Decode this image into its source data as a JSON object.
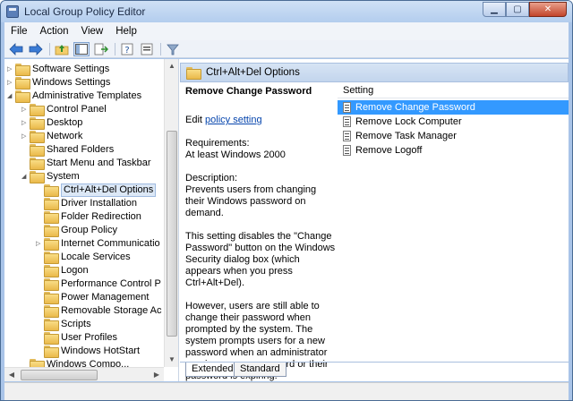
{
  "window": {
    "title": "Local Group Policy Editor"
  },
  "menu": [
    "File",
    "Action",
    "View",
    "Help"
  ],
  "toolbar_icons": [
    "back-arrow-icon",
    "forward-arrow-icon",
    "up-folder-icon",
    "show-hide-tree-icon",
    "export-list-icon",
    "help-icon",
    "properties-icon",
    "filter-icon"
  ],
  "tree": [
    {
      "label": "Software Settings",
      "level": 1,
      "expander": "▷"
    },
    {
      "label": "Windows Settings",
      "level": 1,
      "expander": "▷"
    },
    {
      "label": "Administrative Templates",
      "level": 1,
      "expander": "◢"
    },
    {
      "label": "Control Panel",
      "level": 2,
      "expander": "▷"
    },
    {
      "label": "Desktop",
      "level": 2,
      "expander": "▷"
    },
    {
      "label": "Network",
      "level": 2,
      "expander": "▷"
    },
    {
      "label": "Shared Folders",
      "level": 2,
      "expander": ""
    },
    {
      "label": "Start Menu and Taskbar",
      "level": 2,
      "expander": ""
    },
    {
      "label": "System",
      "level": 2,
      "expander": "◢"
    },
    {
      "label": "Ctrl+Alt+Del Options",
      "level": 3,
      "expander": "",
      "selected": true
    },
    {
      "label": "Driver Installation",
      "level": 3,
      "expander": ""
    },
    {
      "label": "Folder Redirection",
      "level": 3,
      "expander": ""
    },
    {
      "label": "Group Policy",
      "level": 3,
      "expander": ""
    },
    {
      "label": "Internet Communicatio",
      "level": 3,
      "expander": "▷"
    },
    {
      "label": "Locale Services",
      "level": 3,
      "expander": ""
    },
    {
      "label": "Logon",
      "level": 3,
      "expander": ""
    },
    {
      "label": "Performance Control P",
      "level": 3,
      "expander": ""
    },
    {
      "label": "Power Management",
      "level": 3,
      "expander": ""
    },
    {
      "label": "Removable Storage Ac",
      "level": 3,
      "expander": ""
    },
    {
      "label": "Scripts",
      "level": 3,
      "expander": ""
    },
    {
      "label": "User Profiles",
      "level": 3,
      "expander": ""
    },
    {
      "label": "Windows HotStart",
      "level": 3,
      "expander": ""
    },
    {
      "label": "Windows Compo...",
      "level": 2,
      "expander": ""
    }
  ],
  "header": {
    "title": "Ctrl+Alt+Del Options"
  },
  "description": {
    "title": "Remove Change Password",
    "edit_prefix": "Edit ",
    "edit_link": "policy setting",
    "requirements_label": "Requirements:",
    "requirements_value": "At least Windows 2000",
    "description_label": "Description:",
    "description_text": "Prevents users from changing their Windows password on demand.",
    "paragraph2": "This setting disables the \"Change Password\" button on the Windows Security dialog box (which appears when you press Ctrl+Alt+Del).",
    "paragraph3": "However, users are still able to change their password when prompted by the system. The system prompts users for a new password when an administrator requires a new password or their password is expiring."
  },
  "list": {
    "column": "Setting",
    "items": [
      {
        "label": "Remove Change Password",
        "selected": true
      },
      {
        "label": "Remove Lock Computer",
        "selected": false
      },
      {
        "label": "Remove Task Manager",
        "selected": false
      },
      {
        "label": "Remove Logoff",
        "selected": false
      }
    ]
  },
  "tabs": [
    {
      "label": "Extended",
      "active": true
    },
    {
      "label": "Standard",
      "active": false
    }
  ]
}
